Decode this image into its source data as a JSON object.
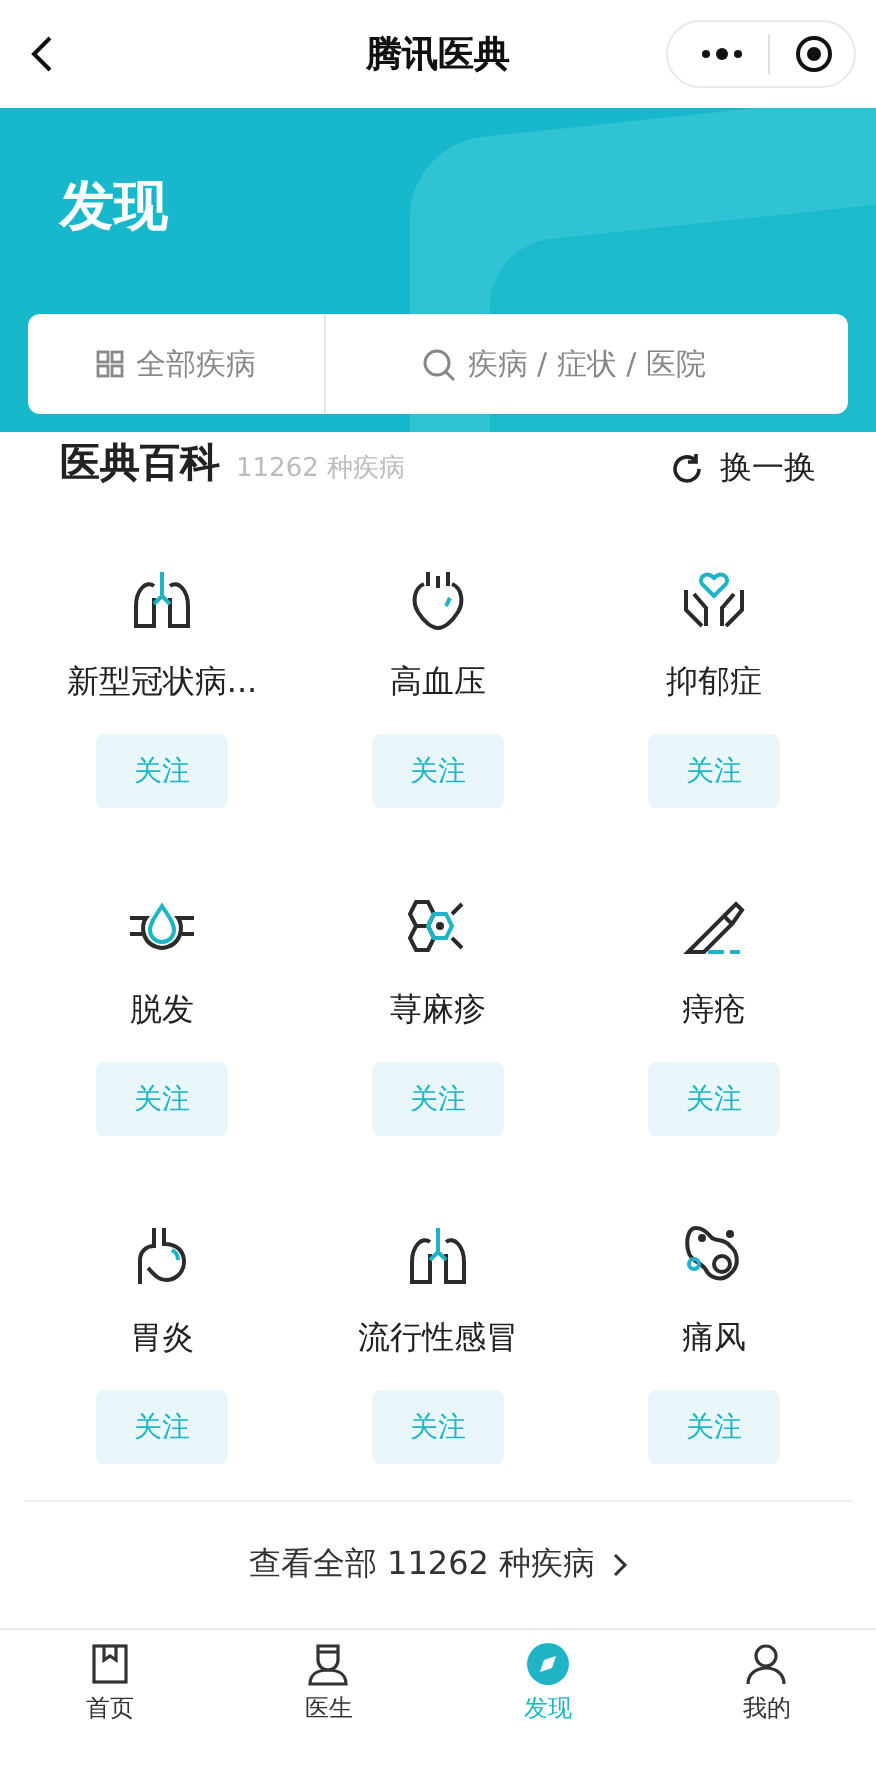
{
  "navbar": {
    "title": "腾讯医典"
  },
  "header": {
    "title": "发现",
    "all_button": "全部疾病",
    "search": {
      "placeholder": "疾病 / 症状 / 医院"
    }
  },
  "section": {
    "title": "医典百科",
    "count": "11262 种疾病",
    "refresh": "换一换"
  },
  "diseases": [
    {
      "kind": "lungs",
      "name": "新型冠状病...",
      "follow": "关注"
    },
    {
      "kind": "heart",
      "name": "高血压",
      "follow": "关注"
    },
    {
      "kind": "hands",
      "name": "抑郁症",
      "follow": "关注"
    },
    {
      "kind": "hair",
      "name": "脱发",
      "follow": "关注"
    },
    {
      "kind": "cells",
      "name": "荨麻疹",
      "follow": "关注"
    },
    {
      "kind": "scalpel",
      "name": "痔疮",
      "follow": "关注"
    },
    {
      "kind": "stomach",
      "name": "胃炎",
      "follow": "关注"
    },
    {
      "kind": "lungs",
      "name": "流行性感冒",
      "follow": "关注"
    },
    {
      "kind": "joint",
      "name": "痛风",
      "follow": "关注"
    }
  ],
  "view_all": "查看全部 11262 种疾病",
  "tabs": [
    {
      "kind": "book",
      "label": "首页",
      "selected": false
    },
    {
      "kind": "doctor",
      "label": "医生",
      "selected": false
    },
    {
      "kind": "compass",
      "label": "发现",
      "selected": true
    },
    {
      "kind": "person",
      "label": "我的",
      "selected": false
    }
  ]
}
